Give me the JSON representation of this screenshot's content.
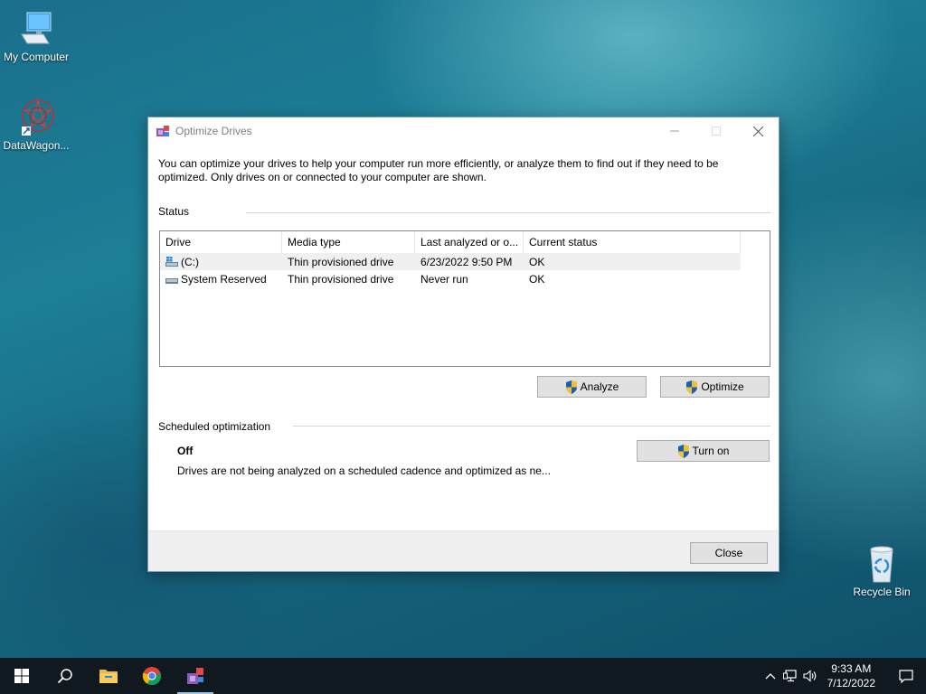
{
  "desktop": {
    "icons": [
      {
        "label": "My Computer"
      },
      {
        "label": "DataWagon..."
      },
      {
        "label": "Recycle Bin"
      }
    ]
  },
  "window": {
    "title": "Optimize Drives",
    "intro": "You can optimize your drives to help your computer run more efficiently, or analyze them to find out if they need to be optimized. Only drives on or connected to your computer are shown.",
    "status_label": "Status",
    "columns": [
      "Drive",
      "Media type",
      "Last analyzed or o...",
      "Current status"
    ],
    "drives": [
      {
        "drive": "(C:)",
        "media": "Thin provisioned drive",
        "last": "6/23/2022 9:50 PM",
        "status": "OK"
      },
      {
        "drive": "System Reserved",
        "media": "Thin provisioned drive",
        "last": "Never run",
        "status": "OK"
      }
    ],
    "analyze_label": "Analyze",
    "optimize_label": "Optimize",
    "scheduled_label": "Scheduled optimization",
    "scheduled_state": "Off",
    "scheduled_desc": "Drives are not being analyzed on a scheduled cadence and optimized as ne...",
    "turn_on_label": "Turn on",
    "close_label": "Close"
  },
  "taskbar": {
    "time": "9:33 AM",
    "date": "7/12/2022"
  },
  "colors": {
    "accent": "#0078d7",
    "taskbar": "#101820"
  }
}
